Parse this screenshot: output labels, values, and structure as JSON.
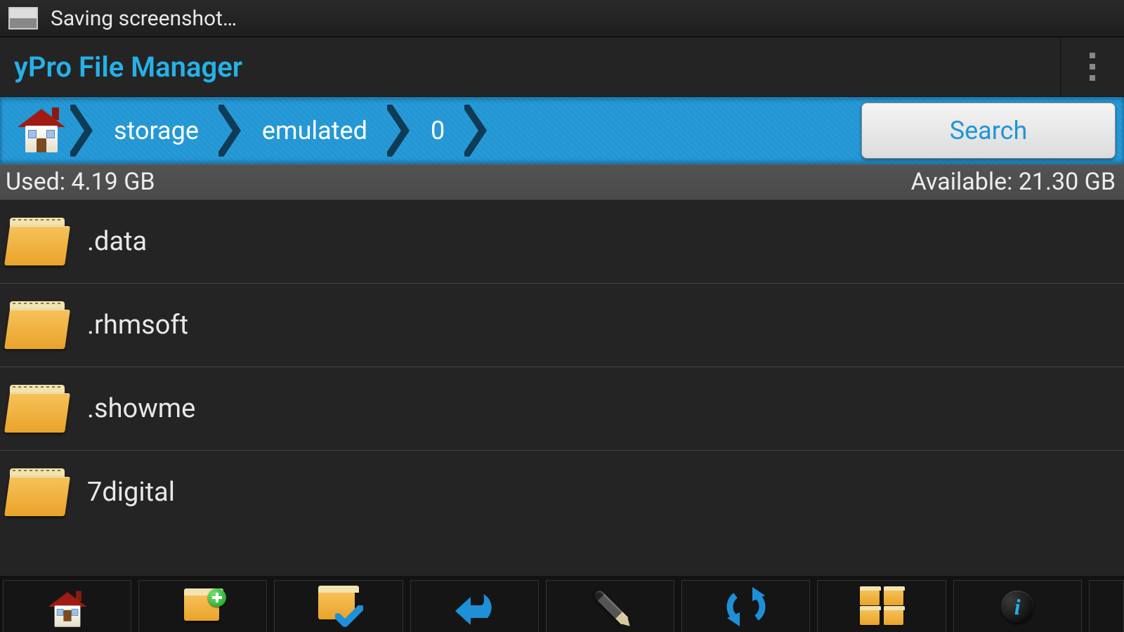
{
  "status_bar": {
    "text": "Saving screenshot…"
  },
  "app": {
    "title": "yPro File Manager"
  },
  "breadcrumb": {
    "items": [
      "storage",
      "emulated",
      "0"
    ],
    "search_label": "Search"
  },
  "storage": {
    "used_label": "Used: 4.19 GB",
    "avail_label": "Available: 21.30 GB"
  },
  "files": [
    {
      "name": ".data"
    },
    {
      "name": ".rhmsoft"
    },
    {
      "name": ".showme"
    },
    {
      "name": "7digital"
    }
  ],
  "toolbar": {
    "home": "home",
    "new_folder": "new-folder",
    "select": "select",
    "back": "back",
    "edit": "edit",
    "refresh": "refresh",
    "multi": "multi-select",
    "info": "info"
  },
  "colors": {
    "accent": "#2196d4",
    "accent_text": "#25b1e8"
  }
}
